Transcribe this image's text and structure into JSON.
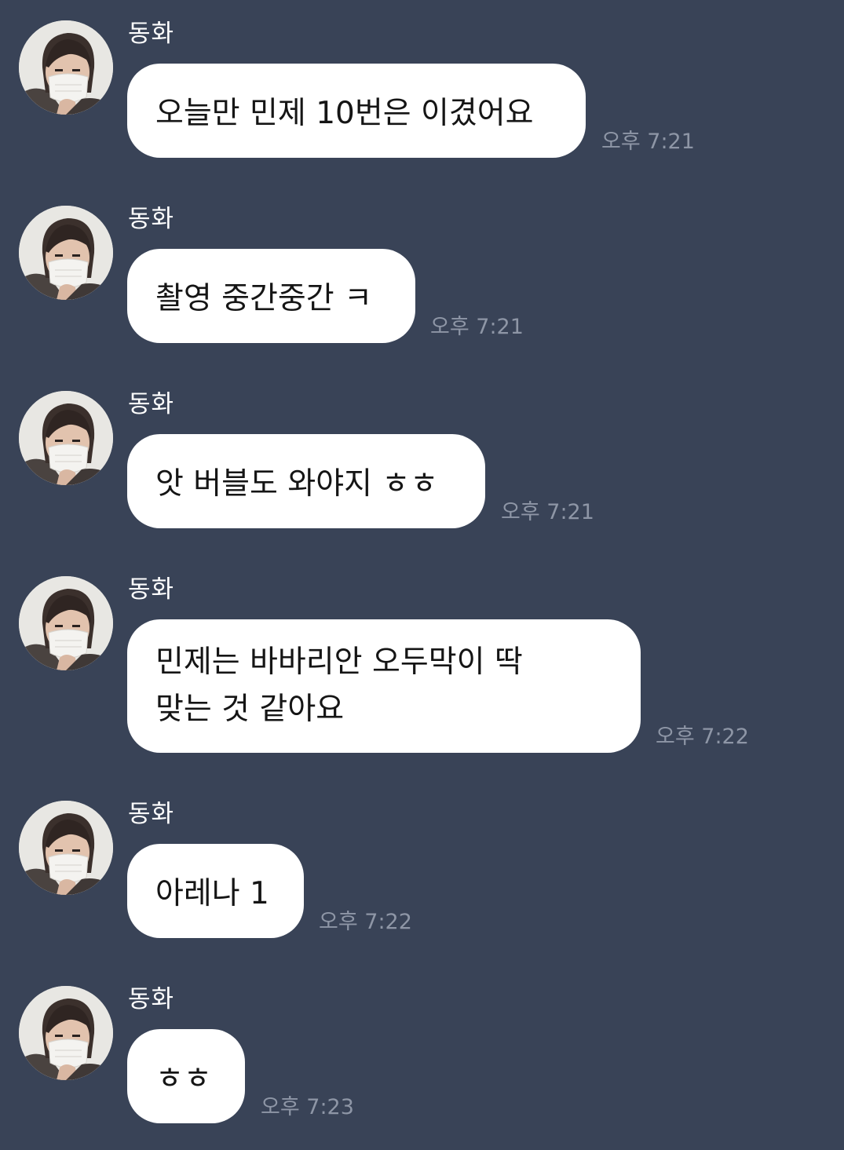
{
  "colors": {
    "background": "#394357",
    "bubble": "#ffffff",
    "sender_text": "#ffffff",
    "message_text": "#151515",
    "timestamp": "#8e96a6"
  },
  "messages": [
    {
      "sender": "동화",
      "lines": [
        "오늘만 민제 10번은 이겼어요"
      ],
      "time": "오후 7:21"
    },
    {
      "sender": "동화",
      "lines": [
        "촬영 중간중간 ㅋ"
      ],
      "time": "오후 7:21"
    },
    {
      "sender": "동화",
      "lines": [
        "앗 버블도 와야지 ㅎㅎ"
      ],
      "time": "오후 7:21"
    },
    {
      "sender": "동화",
      "lines": [
        "민제는 바바리안 오두막이 딱",
        "맞는 것 같아요"
      ],
      "time": "오후 7:22"
    },
    {
      "sender": "동화",
      "lines": [
        "아레나 1"
      ],
      "time": "오후 7:22"
    },
    {
      "sender": "동화",
      "lines": [
        "ㅎㅎ"
      ],
      "time": "오후 7:23"
    }
  ]
}
